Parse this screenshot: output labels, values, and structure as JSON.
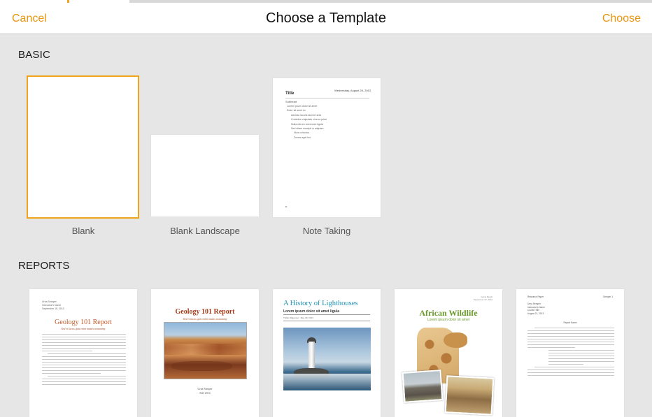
{
  "navbar": {
    "cancel_label": "Cancel",
    "title": "Choose a Template",
    "choose_label": "Choose"
  },
  "sections": {
    "basic": {
      "title": "BASIC",
      "templates": [
        {
          "label": "Blank",
          "selected": true
        },
        {
          "label": "Blank Landscape",
          "selected": false
        },
        {
          "label": "Note Taking",
          "selected": false
        }
      ]
    },
    "reports": {
      "title": "REPORTS"
    }
  },
  "note_taking": {
    "date": "Wednesday, August 28, 2013",
    "title": "Title",
    "subhead": "Subhead",
    "items": [
      "Lorem ipsum dolor sit amet",
      "Dolor sit amet ex",
      "Aenean iaculis laoreet ante",
      "Curabitur vulputate viverra pede",
      "Nulla rutrum commodo ligula",
      "Sed etiam suscipit in aliquam",
      "Nunc a lectus",
      "Donec eget leo"
    ]
  },
  "reports": {
    "geology_plain": {
      "author_block": [
        "Urna Semper",
        "Instructor's Name",
        "September 15, 2013"
      ],
      "title": "Geology 101 Report",
      "subtitle": "Sed et lacus quis enim mattis nonummy"
    },
    "geology_cover": {
      "title": "Geology 101 Report",
      "subtitle": "Sed et lacus quis enim mattis nonummy",
      "author": "Urna Semper",
      "date": "Fall 2014"
    },
    "lighthouses": {
      "title": "A History of Lighthouses",
      "subtitle": "Lorem ipsum dolor sit amet ligula",
      "byline": "Tullam Rapamet · May 26, 2014"
    },
    "wildlife": {
      "top_right": [
        "Canis Mundi",
        "September 27, 2014"
      ],
      "title": "African Wildlife",
      "subtitle": "Lorem ipsum dolor sit amet"
    },
    "research": {
      "header_left": "Research Paper",
      "header_right": "Semper 1",
      "info": [
        "Urna Semper",
        "Instructor's Name",
        "Course Title",
        "August 21, 2013"
      ],
      "heading": "Report Name"
    }
  },
  "colors": {
    "accent": "#e8950f",
    "selection": "#f0a31c",
    "background": "#e6e6e6"
  }
}
